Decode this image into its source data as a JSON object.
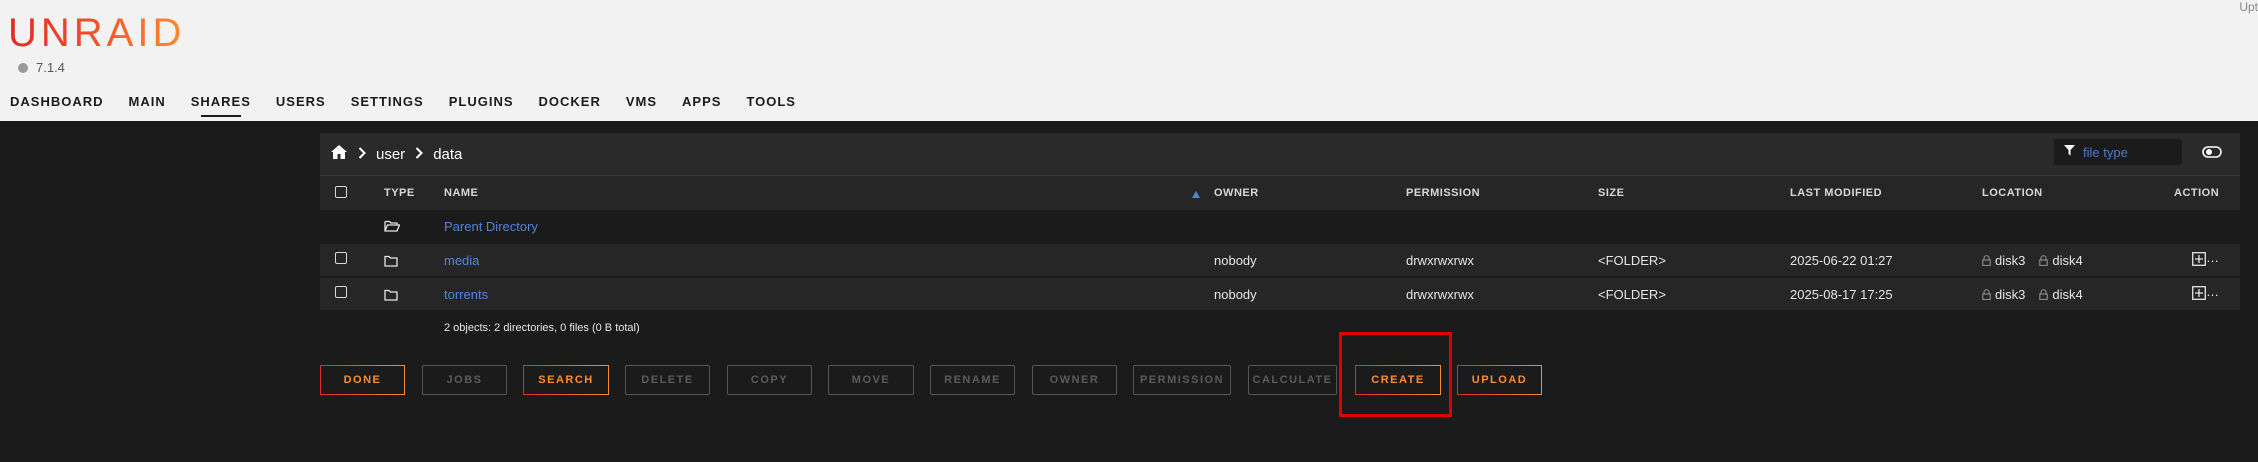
{
  "header": {
    "logo": "UNRAID",
    "version": "7.1.4",
    "uptime_label": "Upt"
  },
  "nav": [
    {
      "label": "DASHBOARD"
    },
    {
      "label": "MAIN"
    },
    {
      "label": "SHARES",
      "active": true
    },
    {
      "label": "USERS"
    },
    {
      "label": "SETTINGS"
    },
    {
      "label": "PLUGINS"
    },
    {
      "label": "DOCKER"
    },
    {
      "label": "VMS"
    },
    {
      "label": "APPS"
    },
    {
      "label": "TOOLS"
    }
  ],
  "breadcrumb": {
    "home_icon": "home-icon",
    "parts": [
      "user",
      "data"
    ]
  },
  "filter": {
    "placeholder": "file type",
    "icon": "filter-icon"
  },
  "columns": {
    "type": "TYPE",
    "name": "NAME",
    "owner": "OWNER",
    "permission": "PERMISSION",
    "size": "SIZE",
    "last_modified": "LAST MODIFIED",
    "location": "LOCATION",
    "action": "ACTION"
  },
  "parent_directory": "Parent Directory",
  "rows": [
    {
      "name": "media",
      "owner": "nobody",
      "permission": "drwxrwxrwx",
      "size": "<FOLDER>",
      "last_modified": "2025-06-22 01:27",
      "locations": [
        "disk3",
        "disk4"
      ]
    },
    {
      "name": "torrents",
      "owner": "nobody",
      "permission": "drwxrwxrwx",
      "size": "<FOLDER>",
      "last_modified": "2025-08-17 17:25",
      "locations": [
        "disk3",
        "disk4"
      ]
    }
  ],
  "summary": "2 objects: 2 directories, 0 files (0 B total)",
  "buttons": {
    "done": "DONE",
    "jobs": "JOBS",
    "search": "SEARCH",
    "delete": "DELETE",
    "copy": "COPY",
    "move": "MOVE",
    "rename": "RENAME",
    "owner": "OWNER",
    "permission": "PERMISSION",
    "calculate": "CALCULATE",
    "create": "CREATE",
    "upload": "UPLOAD"
  },
  "colors": {
    "accent_start": "#e22828",
    "accent_end": "#ff8c2f",
    "link": "#4f86dd",
    "highlight": "#e10000"
  }
}
